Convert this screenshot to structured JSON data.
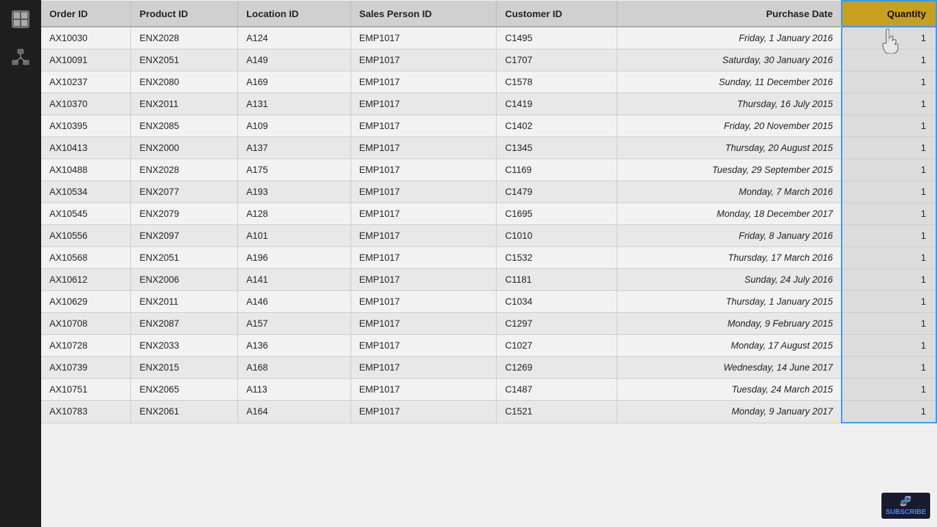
{
  "colors": {
    "sidebar_bg": "#1e1e1e",
    "table_bg": "#f0f0f0",
    "header_bg": "#d0d0d0",
    "quantity_header_bg": "#c8a020",
    "highlight_border": "#3399ff",
    "quantity_cell_bg": "#dcdcdc"
  },
  "sidebar": {
    "icons": [
      {
        "name": "calendar-icon",
        "symbol": "▦"
      },
      {
        "name": "network-icon",
        "symbol": "⋱"
      }
    ]
  },
  "table": {
    "columns": [
      {
        "key": "order_id",
        "label": "Order ID"
      },
      {
        "key": "product_id",
        "label": "Product ID"
      },
      {
        "key": "location_id",
        "label": "Location ID"
      },
      {
        "key": "sales_person_id",
        "label": "Sales Person ID"
      },
      {
        "key": "customer_id",
        "label": "Customer ID"
      },
      {
        "key": "purchase_date",
        "label": "Purchase Date"
      },
      {
        "key": "quantity",
        "label": "Quantity"
      }
    ],
    "rows": [
      {
        "order_id": "AX10030",
        "product_id": "ENX2028",
        "location_id": "A124",
        "sales_person_id": "EMP1017",
        "customer_id": "C1495",
        "purchase_date": "Friday, 1 January 2016",
        "quantity": "1"
      },
      {
        "order_id": "AX10091",
        "product_id": "ENX2051",
        "location_id": "A149",
        "sales_person_id": "EMP1017",
        "customer_id": "C1707",
        "purchase_date": "Saturday, 30 January 2016",
        "quantity": "1"
      },
      {
        "order_id": "AX10237",
        "product_id": "ENX2080",
        "location_id": "A169",
        "sales_person_id": "EMP1017",
        "customer_id": "C1578",
        "purchase_date": "Sunday, 11 December 2016",
        "quantity": "1"
      },
      {
        "order_id": "AX10370",
        "product_id": "ENX2011",
        "location_id": "A131",
        "sales_person_id": "EMP1017",
        "customer_id": "C1419",
        "purchase_date": "Thursday, 16 July 2015",
        "quantity": "1"
      },
      {
        "order_id": "AX10395",
        "product_id": "ENX2085",
        "location_id": "A109",
        "sales_person_id": "EMP1017",
        "customer_id": "C1402",
        "purchase_date": "Friday, 20 November 2015",
        "quantity": "1"
      },
      {
        "order_id": "AX10413",
        "product_id": "ENX2000",
        "location_id": "A137",
        "sales_person_id": "EMP1017",
        "customer_id": "C1345",
        "purchase_date": "Thursday, 20 August 2015",
        "quantity": "1"
      },
      {
        "order_id": "AX10488",
        "product_id": "ENX2028",
        "location_id": "A175",
        "sales_person_id": "EMP1017",
        "customer_id": "C1169",
        "purchase_date": "Tuesday, 29 September 2015",
        "quantity": "1"
      },
      {
        "order_id": "AX10534",
        "product_id": "ENX2077",
        "location_id": "A193",
        "sales_person_id": "EMP1017",
        "customer_id": "C1479",
        "purchase_date": "Monday, 7 March 2016",
        "quantity": "1"
      },
      {
        "order_id": "AX10545",
        "product_id": "ENX2079",
        "location_id": "A128",
        "sales_person_id": "EMP1017",
        "customer_id": "C1695",
        "purchase_date": "Monday, 18 December 2017",
        "quantity": "1"
      },
      {
        "order_id": "AX10556",
        "product_id": "ENX2097",
        "location_id": "A101",
        "sales_person_id": "EMP1017",
        "customer_id": "C1010",
        "purchase_date": "Friday, 8 January 2016",
        "quantity": "1"
      },
      {
        "order_id": "AX10568",
        "product_id": "ENX2051",
        "location_id": "A196",
        "sales_person_id": "EMP1017",
        "customer_id": "C1532",
        "purchase_date": "Thursday, 17 March 2016",
        "quantity": "1"
      },
      {
        "order_id": "AX10612",
        "product_id": "ENX2006",
        "location_id": "A141",
        "sales_person_id": "EMP1017",
        "customer_id": "C1181",
        "purchase_date": "Sunday, 24 July 2016",
        "quantity": "1"
      },
      {
        "order_id": "AX10629",
        "product_id": "ENX2011",
        "location_id": "A146",
        "sales_person_id": "EMP1017",
        "customer_id": "C1034",
        "purchase_date": "Thursday, 1 January 2015",
        "quantity": "1"
      },
      {
        "order_id": "AX10708",
        "product_id": "ENX2087",
        "location_id": "A157",
        "sales_person_id": "EMP1017",
        "customer_id": "C1297",
        "purchase_date": "Monday, 9 February 2015",
        "quantity": "1"
      },
      {
        "order_id": "AX10728",
        "product_id": "ENX2033",
        "location_id": "A136",
        "sales_person_id": "EMP1017",
        "customer_id": "C1027",
        "purchase_date": "Monday, 17 August 2015",
        "quantity": "1"
      },
      {
        "order_id": "AX10739",
        "product_id": "ENX2015",
        "location_id": "A168",
        "sales_person_id": "EMP1017",
        "customer_id": "C1269",
        "purchase_date": "Wednesday, 14 June 2017",
        "quantity": "1"
      },
      {
        "order_id": "AX10751",
        "product_id": "ENX2065",
        "location_id": "A113",
        "sales_person_id": "EMP1017",
        "customer_id": "C1487",
        "purchase_date": "Tuesday, 24 March 2015",
        "quantity": "1"
      },
      {
        "order_id": "AX10783",
        "product_id": "ENX2061",
        "location_id": "A164",
        "sales_person_id": "EMP1017",
        "customer_id": "C1521",
        "purchase_date": "Monday, 9 January 2017",
        "quantity": "1"
      }
    ]
  }
}
